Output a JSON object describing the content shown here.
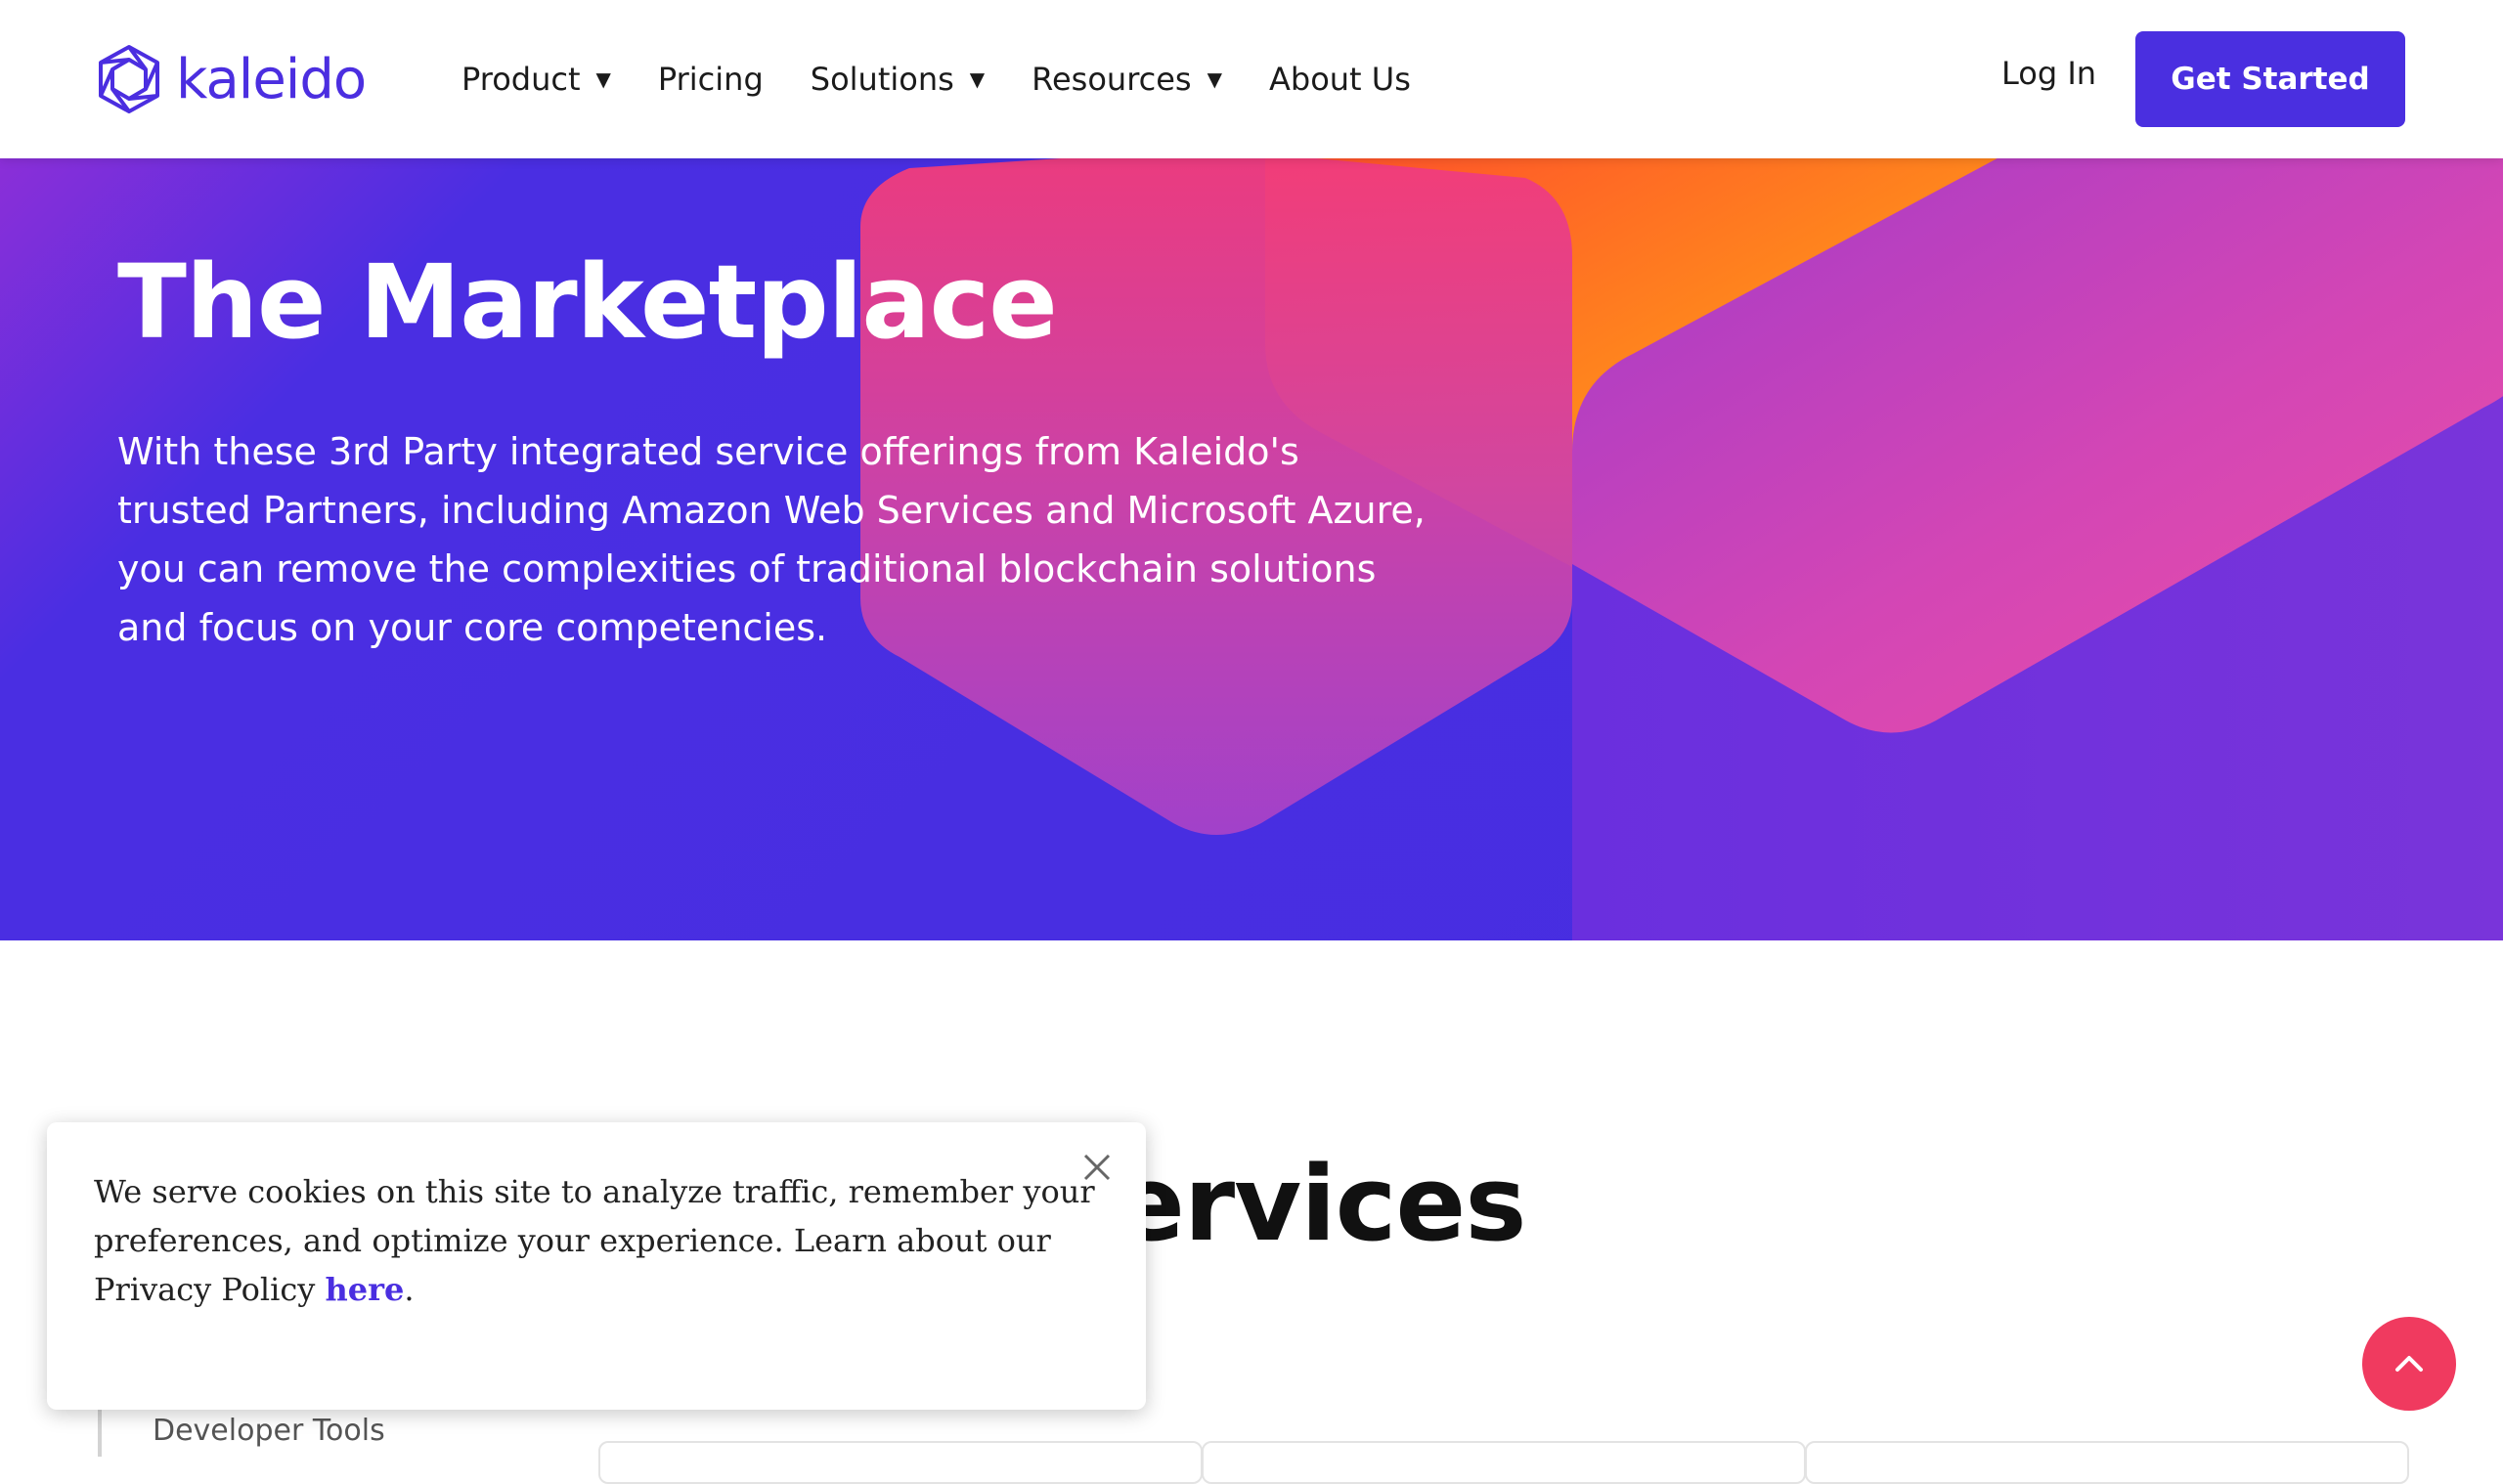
{
  "brand": {
    "name": "kaleido",
    "color": "#4b2ee0"
  },
  "nav": {
    "items": [
      {
        "label": "Product",
        "has_dropdown": true
      },
      {
        "label": "Pricing",
        "has_dropdown": false
      },
      {
        "label": "Solutions",
        "has_dropdown": true
      },
      {
        "label": "Resources",
        "has_dropdown": true
      },
      {
        "label": "About Us",
        "has_dropdown": false
      }
    ],
    "login_label": "Log In",
    "cta_label": "Get Started",
    "caret_glyph": "▼"
  },
  "hero": {
    "title": "The Marketplace",
    "description": "With these 3rd Party integrated service offerings from Kaleido's trusted Partners, including Amazon Web Services and Microsoft Azure, you can remove the complexities of traditional blockchain solutions and focus on your core competencies."
  },
  "section": {
    "title_visible": "ervices",
    "sidebar_item": "Developer Tools"
  },
  "cookie": {
    "text": "We serve cookies on this site to analyze traffic, remember your preferences, and optimize your experience. Learn about our Privacy Policy ",
    "link_label": "here",
    "trailing": "."
  },
  "colors": {
    "accent": "#4a2fe0",
    "scroll_top": "#f03a5f"
  }
}
